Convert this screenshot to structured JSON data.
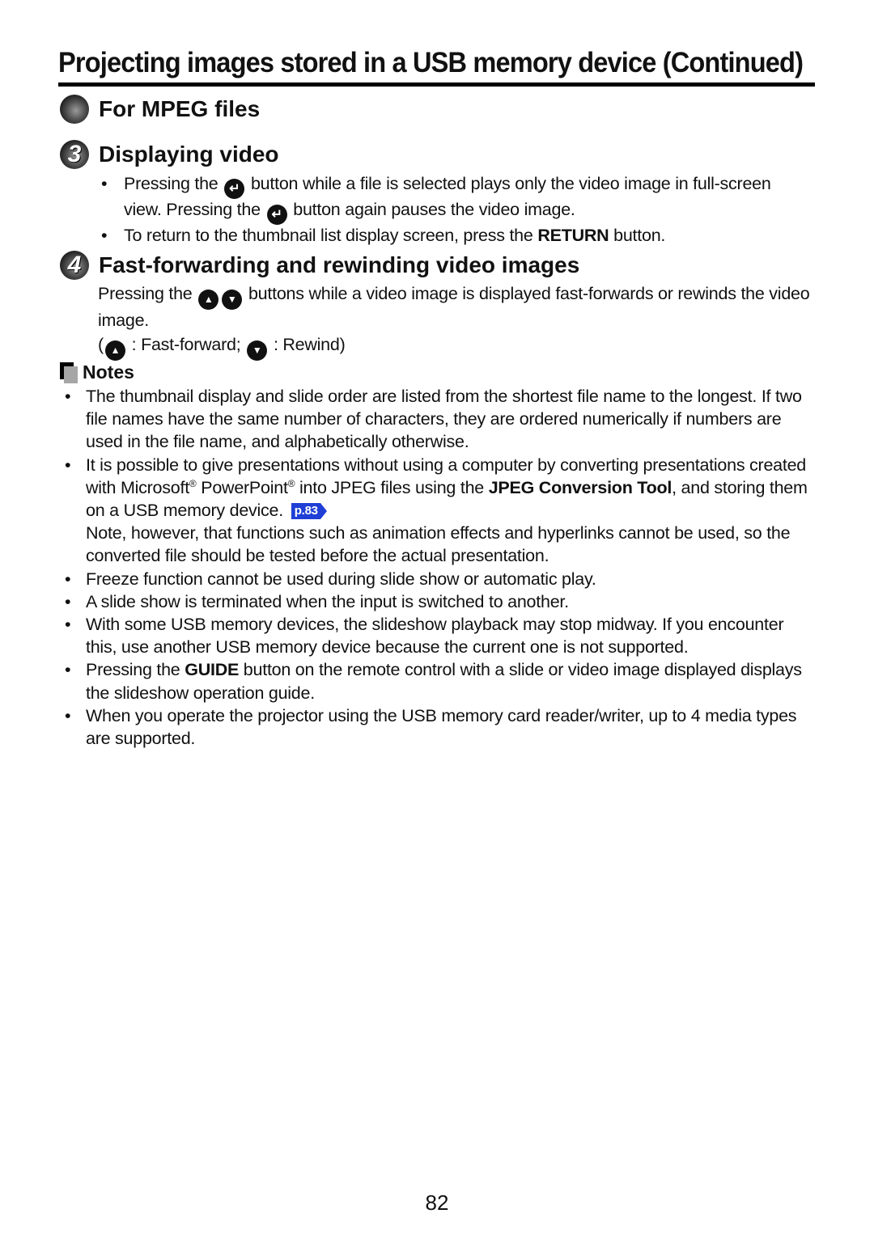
{
  "page": {
    "title": "Projecting images stored in a USB memory device (Continued)",
    "page_number": "82"
  },
  "sections": {
    "mpeg": {
      "heading": "For MPEG files"
    },
    "displaying": {
      "number": "3",
      "heading": "Displaying video",
      "bullets": [
        {
          "a": "Pressing the ",
          "icon": "enter-button-icon",
          "b": " button while a file is selected plays only the video image in full-screen view. Pressing the ",
          "icon2": "enter-button-icon",
          "c": " button again pauses the video image."
        },
        {
          "a": "To return to the thumbnail list display screen, press the ",
          "bold": "RETURN",
          "b": " button."
        }
      ]
    },
    "fastforward": {
      "number": "4",
      "heading": "Fast-forwarding and rewinding video images",
      "text_a": "Pressing the ",
      "text_b": " buttons while a video image is displayed fast-forwards or rewinds the video image.",
      "legend_open": "(",
      "legend_ff": " : Fast-forward; ",
      "legend_rw": " : Rewind)"
    }
  },
  "notes": {
    "heading": "Notes",
    "items": [
      {
        "text": "The thumbnail display and slide order are listed from the shortest file name to the longest. If two file names have the same number of characters, they are ordered numerically if numbers are used in the file name, and alphabetically otherwise."
      },
      {
        "a": "It is possible to give presentations without using a computer by converting presentations created with Microsoft",
        "reg": "®",
        "b": " PowerPoint",
        "c": " into JPEG files using the ",
        "bold": "JPEG Conversion Tool",
        "d": ", and storing them on a USB memory device.",
        "page_ref": "p.83",
        "e": "Note, however, that functions such as animation effects and hyperlinks cannot be used, so the converted file should be tested before the actual presentation."
      },
      {
        "text": "Freeze function cannot be used during slide show or automatic play."
      },
      {
        "text": "A slide show is terminated when the input is switched to another."
      },
      {
        "text": "With some USB memory devices, the slideshow playback may stop midway. If you encounter this, use another USB memory device because the current one is not supported."
      },
      {
        "a": "Pressing the ",
        "bold": "GUIDE",
        "b": " button on the remote control with a slide or video image displayed displays the slideshow operation guide."
      },
      {
        "text": "When you operate the projector using the USB memory card reader/writer, up to 4 media types are supported."
      }
    ]
  },
  "colors": {
    "page_ref_bg": "#1f3fd6",
    "notes_icon_gray": "#a6a6a6"
  }
}
